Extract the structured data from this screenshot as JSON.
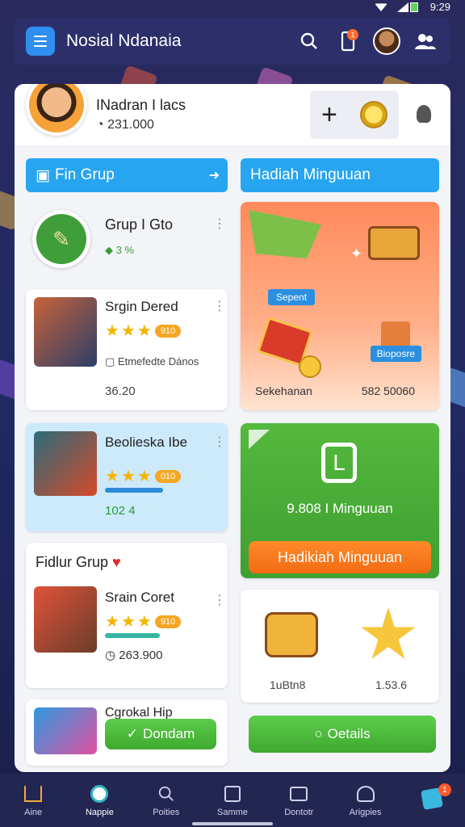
{
  "status": {
    "time": "9:29"
  },
  "header": {
    "title": "Nosial Ndanaia",
    "notification_count": "1"
  },
  "profile": {
    "name": "INadran I lacs",
    "coins": "231.000"
  },
  "left": {
    "section_title": "Fin Grup",
    "group": {
      "name": "Grup I Gto",
      "meta": "3 %"
    },
    "item1": {
      "title": "Srgin Dered",
      "badge": "910",
      "subtitle": "Etmefedte Dános",
      "value": "36.20"
    },
    "item2": {
      "title": "Beolieska Ibe",
      "badge": "010",
      "value": "102 4"
    },
    "featured_title": "Fidlur Grup",
    "item3": {
      "title": "Srain Coret",
      "badge": "910",
      "value": "263.900"
    },
    "item4": {
      "title": "Cgrokal Hip",
      "button": "Dondam"
    }
  },
  "right": {
    "section_title": "Hadiah Minguuan",
    "promo": {
      "tag1": "Sepent",
      "tag2": "Bioposre",
      "left_label": "Sekehanan",
      "right_label": "582 50060"
    },
    "weekly": {
      "amount": "9.808 I Minguuan",
      "button": "Hadikiah Minguuan"
    },
    "collect": {
      "item1": "1uBtn8",
      "item2": "1.53.6"
    },
    "details_button": "Oetails"
  },
  "nav": [
    {
      "label": "Aine",
      "icon": "home-icon"
    },
    {
      "label": "Nappie",
      "icon": "circle-icon"
    },
    {
      "label": "Poities",
      "icon": "search-icon"
    },
    {
      "label": "Samme",
      "icon": "edit-icon"
    },
    {
      "label": "Dontotr",
      "icon": "card-icon"
    },
    {
      "label": "Arigpies",
      "icon": "group-icon"
    },
    {
      "label": "",
      "icon": "store-icon",
      "badge": "1"
    }
  ],
  "colors": {
    "accent": "#27a5f0",
    "green": "#45b435",
    "orange": "#f26b12",
    "gold": "#f5b400"
  }
}
